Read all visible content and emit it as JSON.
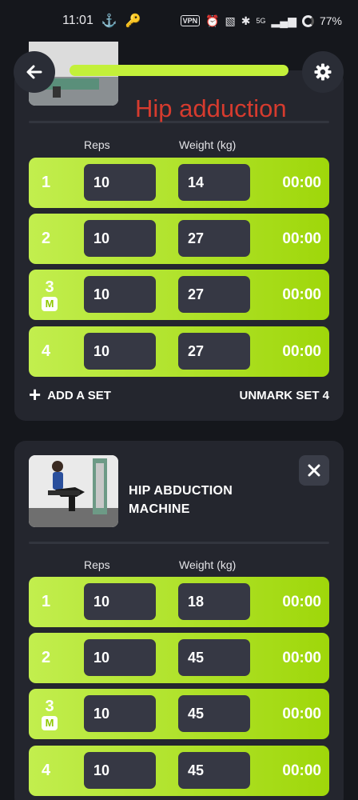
{
  "status_bar": {
    "time": "11:01",
    "vpn": "VPN",
    "network": "5G",
    "battery": "77%"
  },
  "overlay_label": "Hip adduction",
  "columns": {
    "reps": "Reps",
    "weight": "Weight (kg)"
  },
  "cards": [
    {
      "sets": [
        {
          "number": "1",
          "marked": false,
          "reps": "10",
          "weight": "14",
          "timer": "00:00"
        },
        {
          "number": "2",
          "marked": false,
          "reps": "10",
          "weight": "27",
          "timer": "00:00"
        },
        {
          "number": "3",
          "marked": true,
          "mark_label": "M",
          "reps": "10",
          "weight": "27",
          "timer": "00:00"
        },
        {
          "number": "4",
          "marked": false,
          "reps": "10",
          "weight": "27",
          "timer": "00:00"
        }
      ],
      "add_set_label": "ADD A SET",
      "unmark_label": "UNMARK SET 4"
    },
    {
      "title_line1": "HIP ABDUCTION",
      "title_line2": "MACHINE",
      "sets": [
        {
          "number": "1",
          "marked": false,
          "reps": "10",
          "weight": "18",
          "timer": "00:00"
        },
        {
          "number": "2",
          "marked": false,
          "reps": "10",
          "weight": "45",
          "timer": "00:00"
        },
        {
          "number": "3",
          "marked": true,
          "mark_label": "M",
          "reps": "10",
          "weight": "45",
          "timer": "00:00"
        },
        {
          "number": "4",
          "marked": false,
          "reps": "10",
          "weight": "45",
          "timer": "00:00"
        }
      ]
    }
  ],
  "colors": {
    "accent": "#b5e42a",
    "card": "#24262e",
    "background": "#15171c",
    "overlay_text": "#d63b2e"
  },
  "icons": [
    "back-arrow-icon",
    "gear-icon",
    "close-icon",
    "plus-icon"
  ]
}
